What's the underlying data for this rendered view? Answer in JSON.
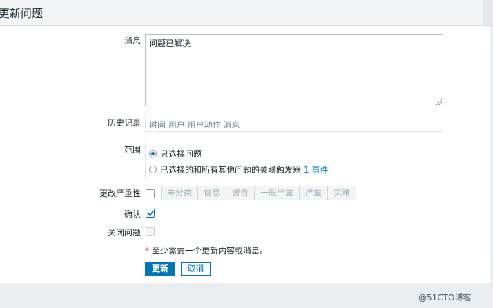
{
  "header": {
    "title": "更新问题"
  },
  "form": {
    "message_label": "消息",
    "message_value": "问题已解决",
    "history_label": "历史记录",
    "history_columns": "时间 用户 用户动作 消息",
    "scope_label": "范围",
    "scope_options": [
      {
        "label": "只选择问题",
        "selected": true
      },
      {
        "label": "已选择的和所有其他问题的关联触发器",
        "link": "1 事件",
        "selected": false
      }
    ],
    "severity_label": "更改严重性",
    "severity_options": [
      "未分类",
      "信息",
      "警告",
      "一般严重",
      "严重",
      "灾难"
    ],
    "ack_label": "确认",
    "close_label": "关闭问题",
    "required_note": "至少需要一个更新内容或消息。",
    "required_star": "*"
  },
  "buttons": {
    "update": "更新",
    "cancel": "取消"
  },
  "watermark": "@51CTO博客",
  "colors": {
    "accent": "#0275b8",
    "required": "#e33734"
  }
}
